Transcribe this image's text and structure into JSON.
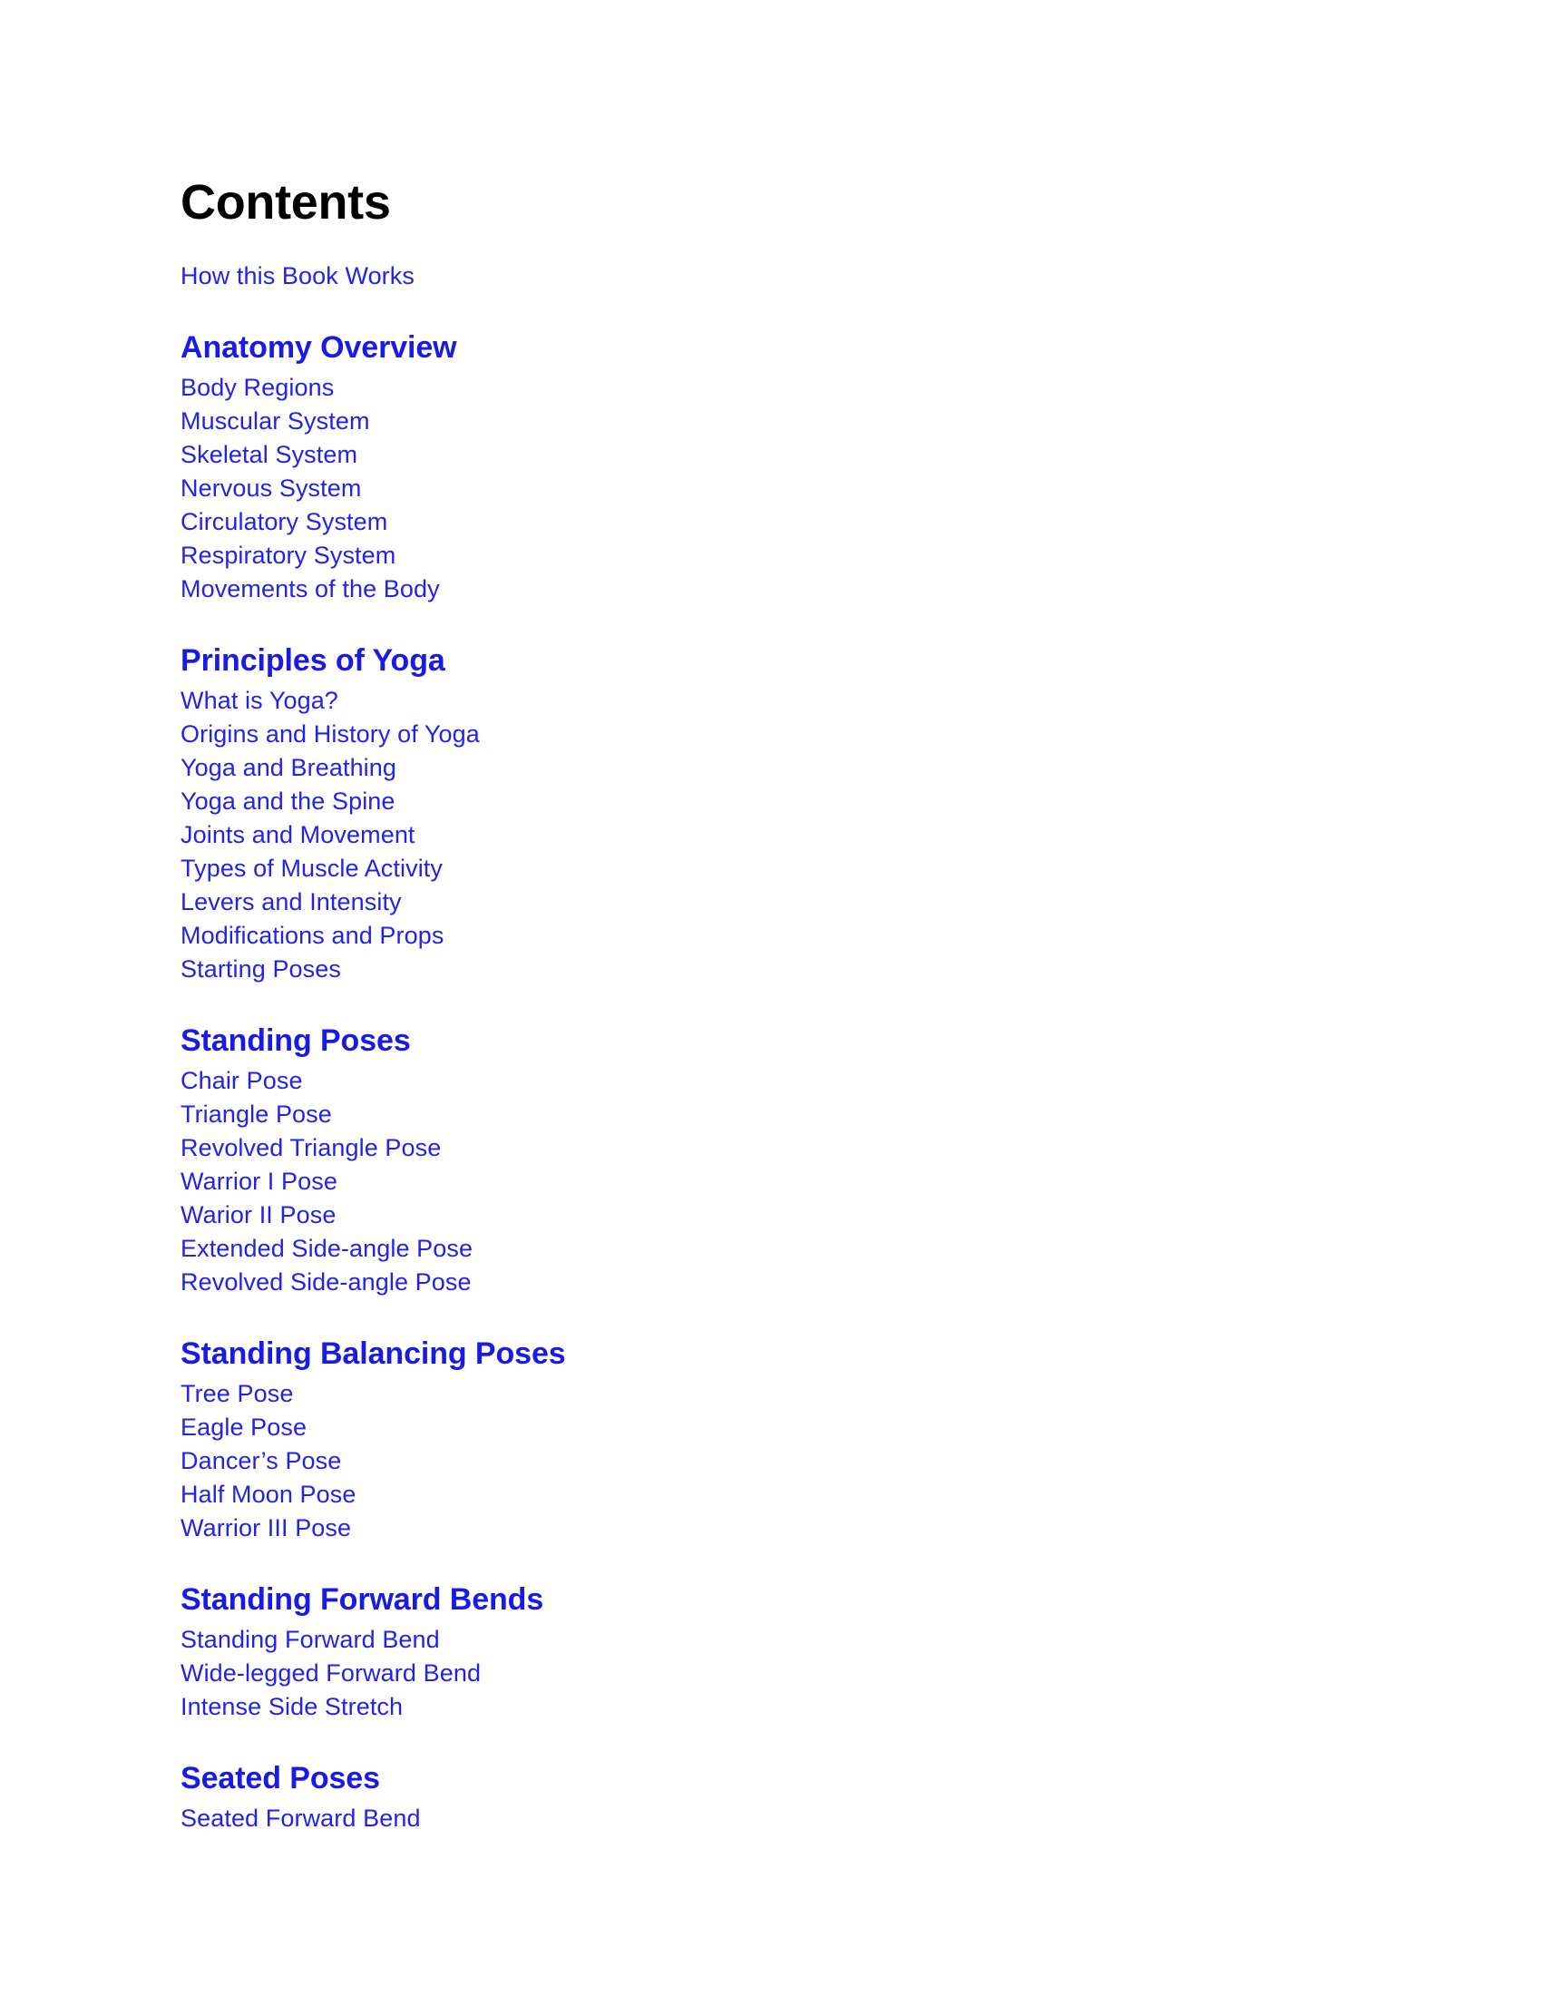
{
  "document": {
    "title": "Contents",
    "colors": {
      "title_text": "#000000",
      "heading_blue": "#1a1ae8",
      "item_blue": "#2222ee",
      "background": "#ffffff"
    }
  },
  "intro": {
    "items": [
      {
        "label": "How this Book Works"
      }
    ]
  },
  "sections": [
    {
      "heading": "Anatomy Overview",
      "items": [
        {
          "label": "Body Regions"
        },
        {
          "label": "Muscular System"
        },
        {
          "label": "Skeletal System"
        },
        {
          "label": "Nervous System"
        },
        {
          "label": "Circulatory System"
        },
        {
          "label": "Respiratory System"
        },
        {
          "label": "Movements of the Body"
        }
      ]
    },
    {
      "heading": "Principles of Yoga",
      "items": [
        {
          "label": "What is Yoga?"
        },
        {
          "label": "Origins and History of Yoga"
        },
        {
          "label": "Yoga and Breathing"
        },
        {
          "label": "Yoga and the Spine"
        },
        {
          "label": "Joints and Movement"
        },
        {
          "label": "Types of Muscle Activity"
        },
        {
          "label": "Levers and Intensity"
        },
        {
          "label": "Modifications and Props"
        },
        {
          "label": "Starting Poses"
        }
      ]
    },
    {
      "heading": "Standing Poses",
      "items": [
        {
          "label": "Chair Pose"
        },
        {
          "label": "Triangle Pose"
        },
        {
          "label": "Revolved Triangle Pose"
        },
        {
          "label": "Warrior I Pose"
        },
        {
          "label": "Warior II Pose"
        },
        {
          "label": "Extended Side-angle Pose"
        },
        {
          "label": "Revolved Side-angle Pose"
        }
      ]
    },
    {
      "heading": "Standing Balancing Poses",
      "items": [
        {
          "label": "Tree Pose"
        },
        {
          "label": "Eagle Pose"
        },
        {
          "label": "Dancer’s Pose"
        },
        {
          "label": "Half Moon Pose"
        },
        {
          "label": "Warrior III Pose"
        }
      ]
    },
    {
      "heading": "Standing Forward Bends",
      "items": [
        {
          "label": "Standing Forward Bend"
        },
        {
          "label": "Wide-legged Forward Bend"
        },
        {
          "label": "Intense Side Stretch"
        }
      ]
    },
    {
      "heading": "Seated Poses",
      "items": [
        {
          "label": "Seated Forward Bend"
        }
      ]
    }
  ]
}
